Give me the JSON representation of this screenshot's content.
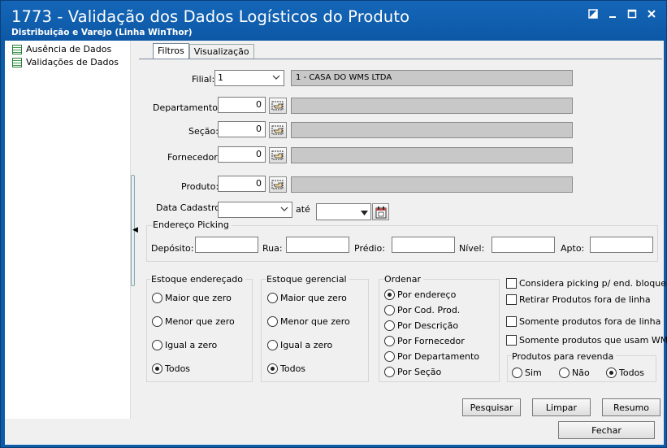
{
  "window": {
    "title": "1773 - Validação dos Dados Logísticos do Produto",
    "subtitle": "Distribuição e Varejo (Linha WinThor)"
  },
  "tree": {
    "items": [
      {
        "label": "Ausência de Dados"
      },
      {
        "label": "Validações de Dados"
      }
    ]
  },
  "tabs": [
    {
      "label": "Filtros"
    },
    {
      "label": "Visualização"
    }
  ],
  "filters": {
    "filial_label": "Filial:",
    "filial_value": "1",
    "filial_name": "1 - CASA DO WMS LTDA",
    "departamento_label": "Departamento:",
    "departamento_value": "0",
    "secao_label": "Seção:",
    "secao_value": "0",
    "fornecedor_label": "Fornecedor:",
    "fornecedor_value": "0",
    "produto_label": "Produto:",
    "produto_value": "0",
    "data_cadastro_label": "Data Cadastro:",
    "ate_label": "até"
  },
  "endereco": {
    "title": "Endereço Picking",
    "deposito_label": "Depósito:",
    "rua_label": "Rua:",
    "predio_label": "Prédio:",
    "nivel_label": "Nível:",
    "apto_label": "Apto:"
  },
  "estoque_enderecado": {
    "title": "Estoque endereçado",
    "options": [
      "Maior que zero",
      "Menor que zero",
      "Igual a zero",
      "Todos"
    ],
    "selected": "Todos"
  },
  "estoque_gerencial": {
    "title": "Estoque gerencial",
    "options": [
      "Maior que zero",
      "Menor que zero",
      "Igual a zero",
      "Todos"
    ],
    "selected": "Todos"
  },
  "ordenar": {
    "title": "Ordenar",
    "options": [
      "Por endereço",
      "Por Cod. Prod.",
      "Por Descrição",
      "Por Fornecedor",
      "Por Departamento",
      "Por Seção"
    ],
    "selected": "Por endereço"
  },
  "checks": {
    "considera_picking": "Considera picking p/ end. bloqueado",
    "retirar_fora_linha": "Retirar Produtos fora de linha",
    "somente_fora_linha": "Somente produtos fora de linha",
    "somente_wms": "Somente produtos que usam WMS"
  },
  "revenda": {
    "title": "Produtos para revenda",
    "options": [
      "Sim",
      "Não",
      "Todos"
    ],
    "selected": "Todos"
  },
  "buttons": {
    "pesquisar": "Pesquisar",
    "limpar": "Limpar",
    "resumo": "Resumo",
    "fechar": "Fechar"
  }
}
